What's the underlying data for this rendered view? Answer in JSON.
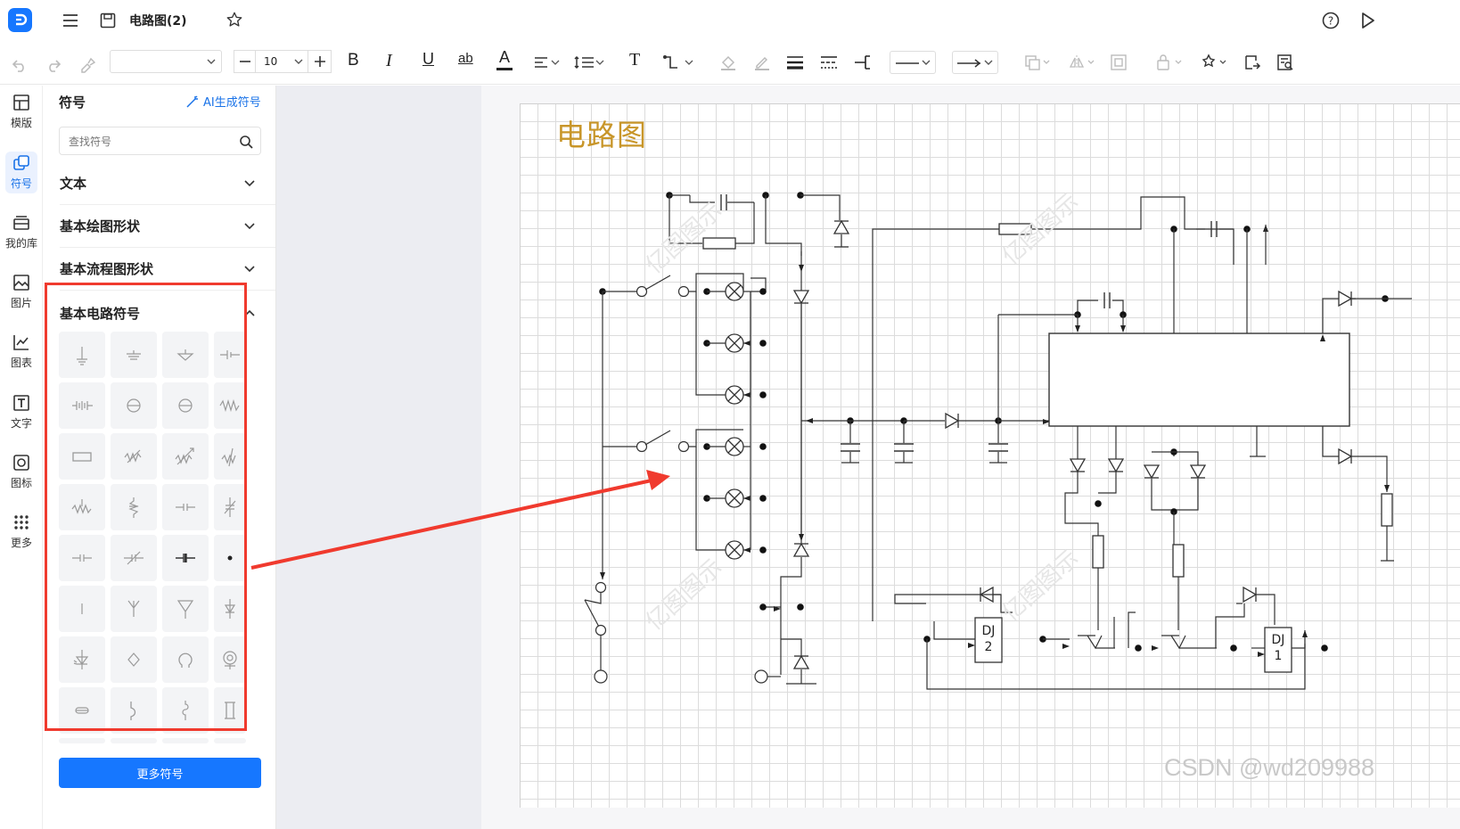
{
  "app": {
    "title": "电路图(2)",
    "colors": {
      "brand": "#1677ff",
      "accent": "#1a73e8",
      "annotation": "#f03a2e",
      "title_gold": "#c8962a"
    }
  },
  "toolbar": {
    "font_name": "",
    "font_size": "10",
    "bold": "B",
    "italic": "I",
    "underline": "U",
    "strike": "ab",
    "text_color": "A",
    "text_tool": "T"
  },
  "nav": [
    {
      "label": "模版",
      "icon": "template-icon"
    },
    {
      "label": "符号",
      "icon": "symbol-icon",
      "active": true
    },
    {
      "label": "我的库",
      "icon": "library-icon"
    },
    {
      "label": "图片",
      "icon": "image-icon"
    },
    {
      "label": "图表",
      "icon": "chart-icon"
    },
    {
      "label": "文字",
      "icon": "text-icon"
    },
    {
      "label": "图标",
      "icon": "icon-icon"
    },
    {
      "label": "更多",
      "icon": "more-icon"
    }
  ],
  "panel": {
    "title": "符号",
    "ai_link": "AI生成符号",
    "search_placeholder": "查找符号",
    "sections": [
      "文本",
      "基本绘图形状",
      "基本流程图形状",
      "基本电路符号"
    ],
    "more_button": "更多符号"
  },
  "canvas": {
    "diagram_title": "电路图",
    "relay_labels": [
      {
        "top": "DJ",
        "bottom": "2"
      },
      {
        "top": "DJ",
        "bottom": "1"
      }
    ],
    "watermark": "亿图图示"
  },
  "footer_watermark": "CSDN @wd209988"
}
